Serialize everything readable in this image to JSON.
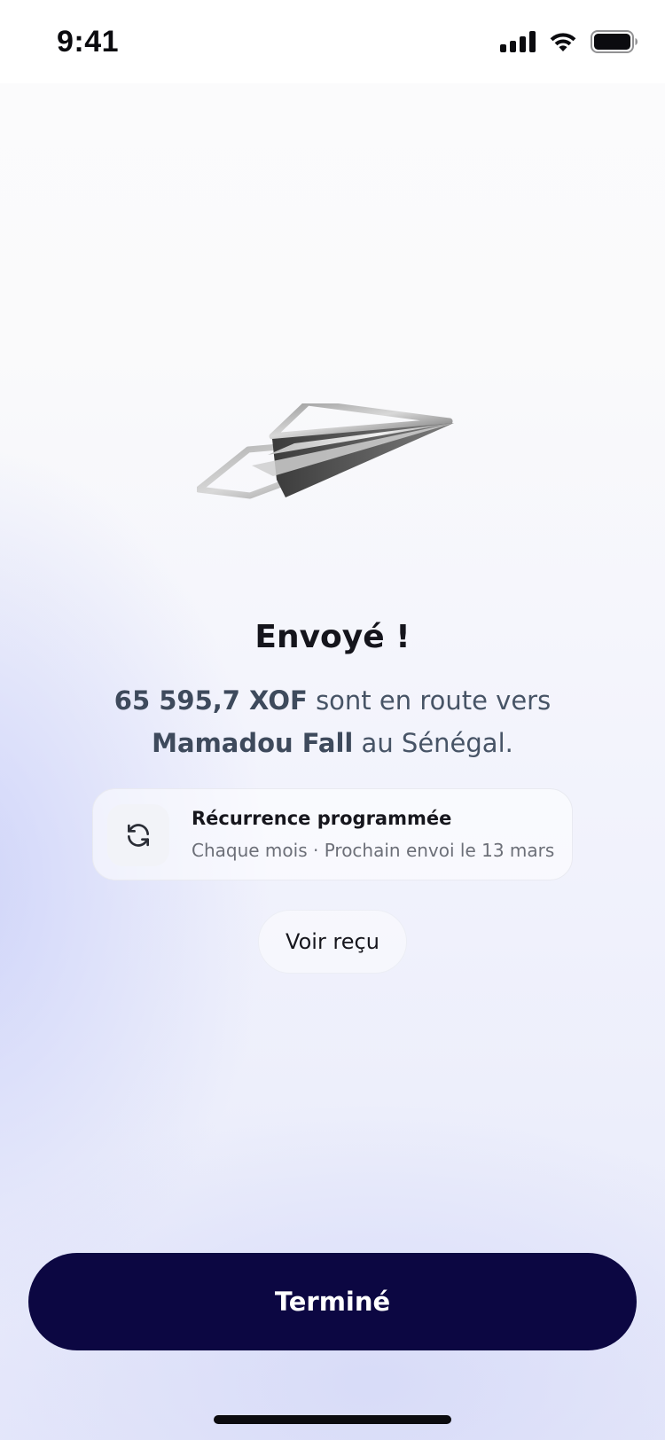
{
  "status_bar": {
    "time": "9:41",
    "icons": [
      "cellular-signal-icon",
      "wifi-icon",
      "battery-icon"
    ]
  },
  "illustration": {
    "icon": "paper-plane-icon"
  },
  "confirmation": {
    "title": "Envoyé !",
    "amount": "65 595,7 XOF",
    "text_1": " sont en route vers",
    "recipient": "Mamadou Fall",
    "text_2": " au Sénégal."
  },
  "recurrence": {
    "icon": "refresh-icon",
    "title": "Récurrence programmée",
    "subtitle": "Chaque mois · Prochain envoi le 13 mars"
  },
  "actions": {
    "receipt_label": "Voir reçu",
    "done_label": "Terminé"
  },
  "colors": {
    "primary_button": "#0c0742",
    "text_dark": "#15151c",
    "text_muted": "#475466",
    "background_tint": "#e6e8fa"
  }
}
